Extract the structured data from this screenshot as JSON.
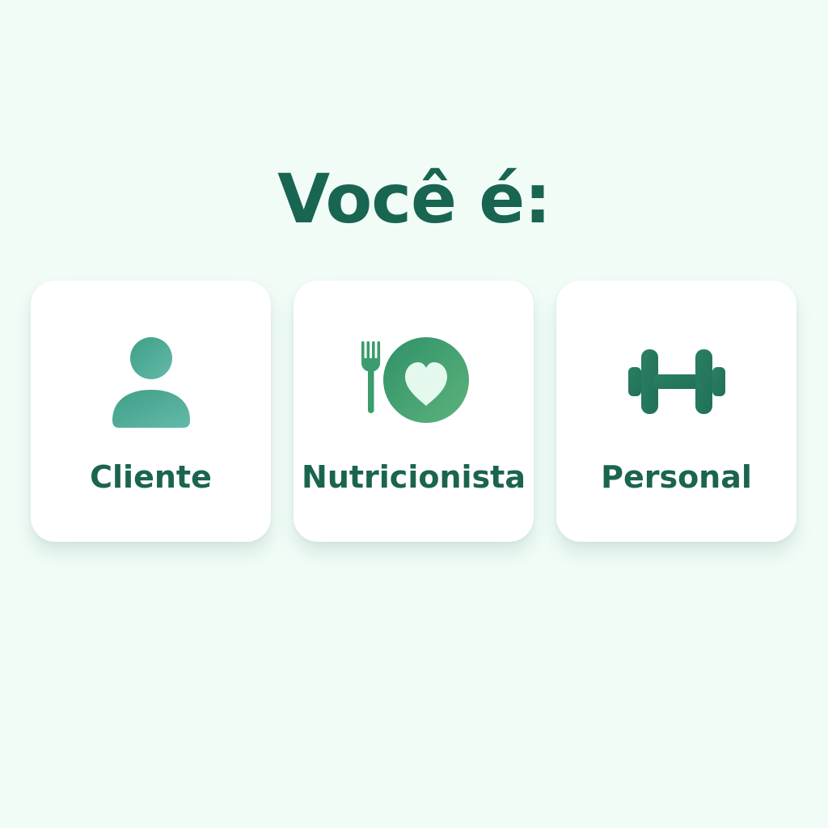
{
  "prompt": {
    "title": "Você é:"
  },
  "options": [
    {
      "label": "Cliente",
      "icon": "user-icon",
      "color": "#4fae9a"
    },
    {
      "label": "Nutricionista",
      "icon": "fork-heart-plate-icon",
      "color": "#3e9e68"
    },
    {
      "label": "Personal",
      "icon": "dumbbell-icon",
      "color": "#2a7a62"
    }
  ],
  "colors": {
    "background": "#f1fcf7",
    "card": "#ffffff",
    "text": "#186552"
  }
}
